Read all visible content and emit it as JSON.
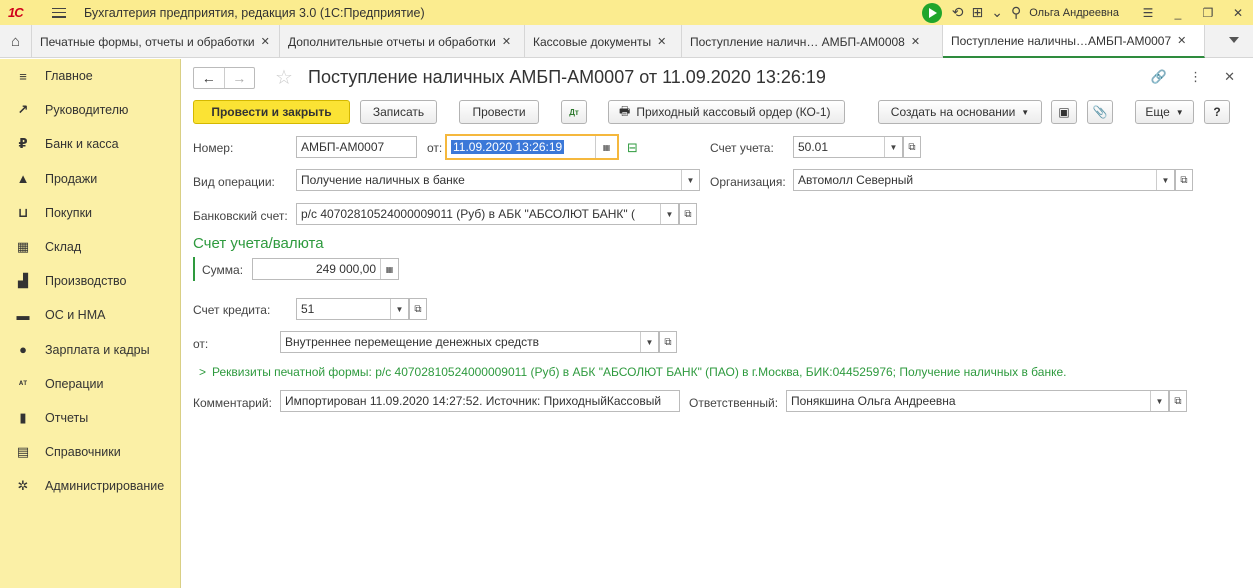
{
  "app": {
    "logo": "1С",
    "title": "Бухгалтерия предприятия, редакция 3.0  (1С:Предприятие)",
    "user": "Ольга Андреевна"
  },
  "tabs": [
    {
      "label": "Печатные формы, отчеты и обработки"
    },
    {
      "label": "Дополнительные отчеты и обработки"
    },
    {
      "label": "Кассовые документы"
    },
    {
      "label": "Поступление наличн…  АМБП-АМ0008"
    },
    {
      "label": "Поступление наличны…АМБП-АМ0007"
    }
  ],
  "sidebar": {
    "items": [
      {
        "label": "Главное",
        "icon": "menu-icon"
      },
      {
        "label": "Руководителю",
        "icon": "trend-icon"
      },
      {
        "label": "Банк и касса",
        "icon": "ruble-icon"
      },
      {
        "label": "Продажи",
        "icon": "bag-icon"
      },
      {
        "label": "Покупки",
        "icon": "cart-icon"
      },
      {
        "label": "Склад",
        "icon": "warehouse-icon"
      },
      {
        "label": "Производство",
        "icon": "factory-icon"
      },
      {
        "label": "ОС и НМА",
        "icon": "truck-icon"
      },
      {
        "label": "Зарплата и кадры",
        "icon": "person-icon"
      },
      {
        "label": "Операции",
        "icon": "dt-kt-icon"
      },
      {
        "label": "Отчеты",
        "icon": "bar-chart-icon"
      },
      {
        "label": "Справочники",
        "icon": "book-icon"
      },
      {
        "label": "Администрирование",
        "icon": "gear-icon"
      }
    ]
  },
  "document": {
    "title": "Поступление наличных АМБП-АМ0007 от 11.09.2020 13:26:19"
  },
  "toolbar": {
    "post_close": "Провести и закрыть",
    "save": "Записать",
    "post": "Провести",
    "dt_kt": "Дт Кт",
    "print": "Приходный кассовый ордер (КО-1)",
    "create_based": "Создать на основании",
    "more": "Еще",
    "help": "?"
  },
  "form": {
    "number_label": "Номер:",
    "number": "АМБП-АМ0007",
    "date_label": "от:",
    "date": "11.09.2020 13:26:19",
    "account_label": "Счет учета:",
    "account": "50.01",
    "operation_label": "Вид операции:",
    "operation": "Получение наличных в банке",
    "org_label": "Организация:",
    "org": "Автомолл Северный",
    "bank_label": "Банковский счет:",
    "bank": "р/с 40702810524000009011 (Руб) в АБК \"АБСОЛЮТ БАНК\" (",
    "section_title": "Счет учета/валюта",
    "sum_label": "Сумма:",
    "sum": "249 000,00",
    "credit_label": "Счет кредита:",
    "credit": "51",
    "from_label": "от:",
    "from": "Внутреннее перемещение денежных средств",
    "requisites": "Реквизиты печатной формы: р/с 40702810524000009011 (Руб) в АБК \"АБСОЛЮТ БАНК\" (ПАО) в г.Москва, БИК:044525976; Получение наличных в банке.",
    "comment_label": "Комментарий:",
    "comment": "Импортирован 11.09.2020 14:27:52. Источник: ПриходныйКассовый",
    "resp_label": "Ответственный:",
    "resp": "Понякшина Ольга Андреевна"
  },
  "colors": {
    "title_bar": "#fbec8f",
    "sidebar": "#fbf0a6",
    "primary_button": "#fbe334",
    "accent_green": "#2e9a3e"
  }
}
